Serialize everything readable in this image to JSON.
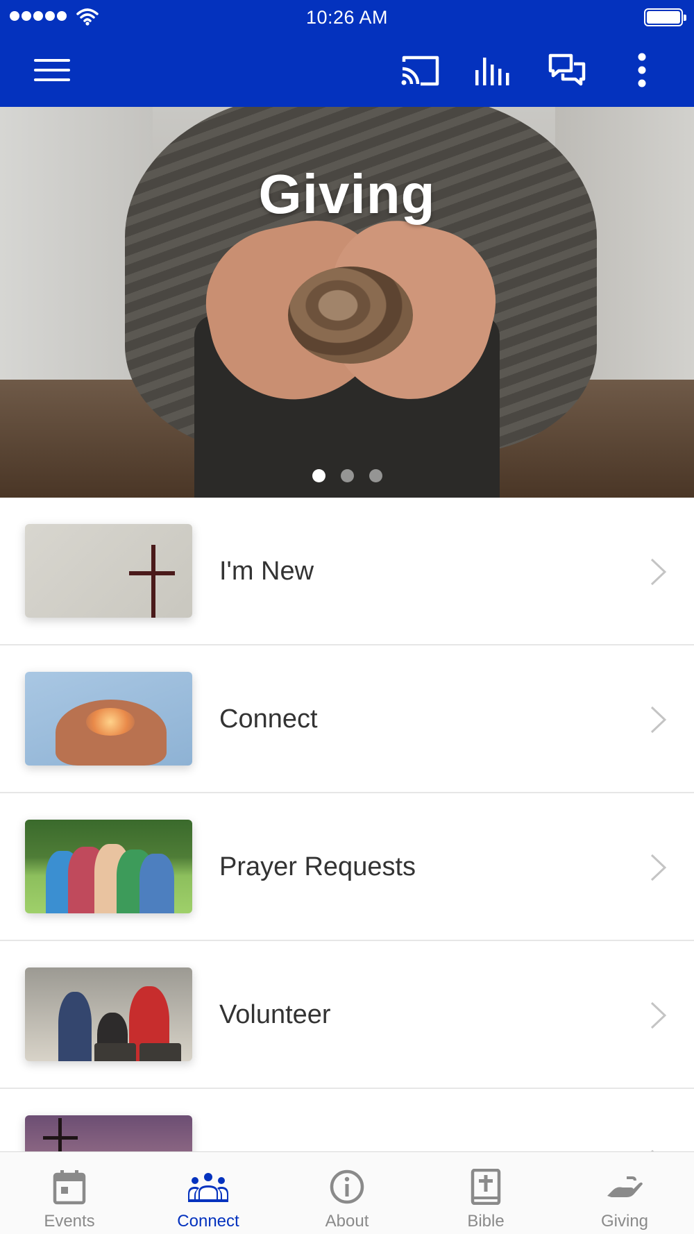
{
  "status_bar": {
    "time": "10:26 AM"
  },
  "app_bar": {
    "icons": [
      "menu-icon",
      "cast-icon",
      "equalizer-icon",
      "chat-icon",
      "more-vert-icon"
    ],
    "background_color": "#0432be"
  },
  "hero": {
    "title": "Giving",
    "slides_total": 3,
    "active_slide": 1
  },
  "list": {
    "items": [
      {
        "label": "I'm New"
      },
      {
        "label": "Connect"
      },
      {
        "label": "Prayer Requests"
      },
      {
        "label": "Volunteer"
      },
      {
        "label": ""
      }
    ]
  },
  "tabbar": {
    "active": "Connect",
    "active_color": "#0432be",
    "tabs": [
      {
        "label": "Events",
        "icon": "calendar-icon"
      },
      {
        "label": "Connect",
        "icon": "group-icon"
      },
      {
        "label": "About",
        "icon": "info-icon"
      },
      {
        "label": "Bible",
        "icon": "bible-icon"
      },
      {
        "label": "Giving",
        "icon": "giving-hand-icon"
      }
    ]
  }
}
